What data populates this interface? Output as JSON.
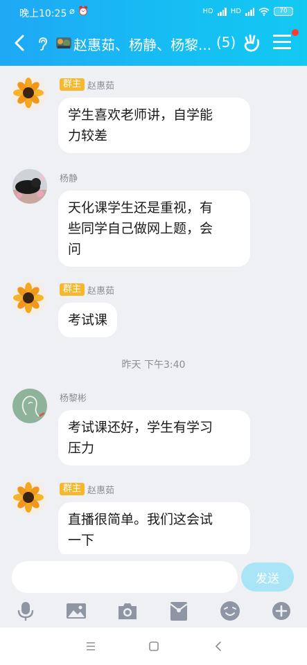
{
  "status": {
    "time": "晚上10:25",
    "extra_icons": "⌀ ⏰",
    "network": "HD",
    "battery": "70"
  },
  "header": {
    "title": "赵惠茹、杨静、杨黎...",
    "member_count": "(5)",
    "back_icon": "chevron-left-icon",
    "accent": "#1fa8f5"
  },
  "messages": [
    {
      "sender": "赵惠茹",
      "badge": "群主",
      "text_lines": [
        "学生喜欢老师讲，自学能",
        "力较差"
      ]
    },
    {
      "sender": "杨静",
      "badge": "",
      "text_lines": [
        "天化课学生还是重视，有",
        "些同学自己做网上题，会",
        "问"
      ]
    },
    {
      "sender": "赵惠茹",
      "badge": "群主",
      "text_lines": [
        "考试课"
      ]
    },
    {
      "sender": "杨黎彬",
      "badge": "",
      "text_lines": [
        "考试课还好，学生有学习",
        "压力"
      ]
    },
    {
      "sender": "赵惠茹",
      "badge": "群主",
      "text_lines": [
        "直播很简单。我们这会试",
        "一下"
      ]
    }
  ],
  "timestamp": "昨天 下午3:40",
  "input": {
    "value": "",
    "placeholder": "",
    "send_label": "发送"
  },
  "toolbar": [
    "microphone-icon",
    "image-icon",
    "camera-icon",
    "red-packet-icon",
    "emoji-icon",
    "plus-icon"
  ],
  "navbar": [
    "menu-icon",
    "home-icon",
    "back-icon"
  ]
}
